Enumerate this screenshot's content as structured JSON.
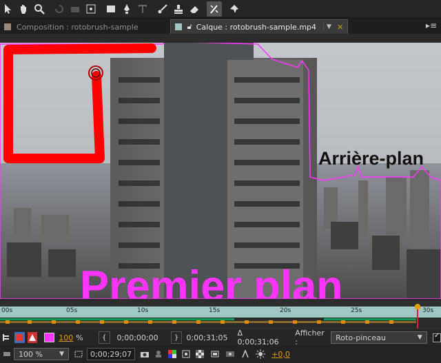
{
  "tabs": [
    {
      "label": "Composition : rotobrush-sample",
      "active": false
    },
    {
      "label": "Calque : rotobrush-sample.mp4",
      "active": true
    }
  ],
  "viewer": {
    "background_label": "Arrière-plan",
    "foreground_label": "Premier plan"
  },
  "timeline": {
    "ticks": [
      "00s",
      "05s",
      "10s",
      "15s",
      "20s",
      "25s",
      "30s"
    ]
  },
  "controls": {
    "zoom_percent": "100",
    "percent_sign": "%",
    "in_time": "0;00;00;00",
    "out_time": "0;00;31;05",
    "duration": "Δ 0;00;31;06",
    "show_label": "Afficher :",
    "show_value": "Roto-pinceau",
    "magnification": "100 %",
    "current_time": "0;00;29;07",
    "exposure": "+0,0"
  },
  "colors": {
    "accent": "#e79b00",
    "magenta": "#ff33ff",
    "roto_red": "#ff0000",
    "ruler": "#9fc8c4"
  }
}
